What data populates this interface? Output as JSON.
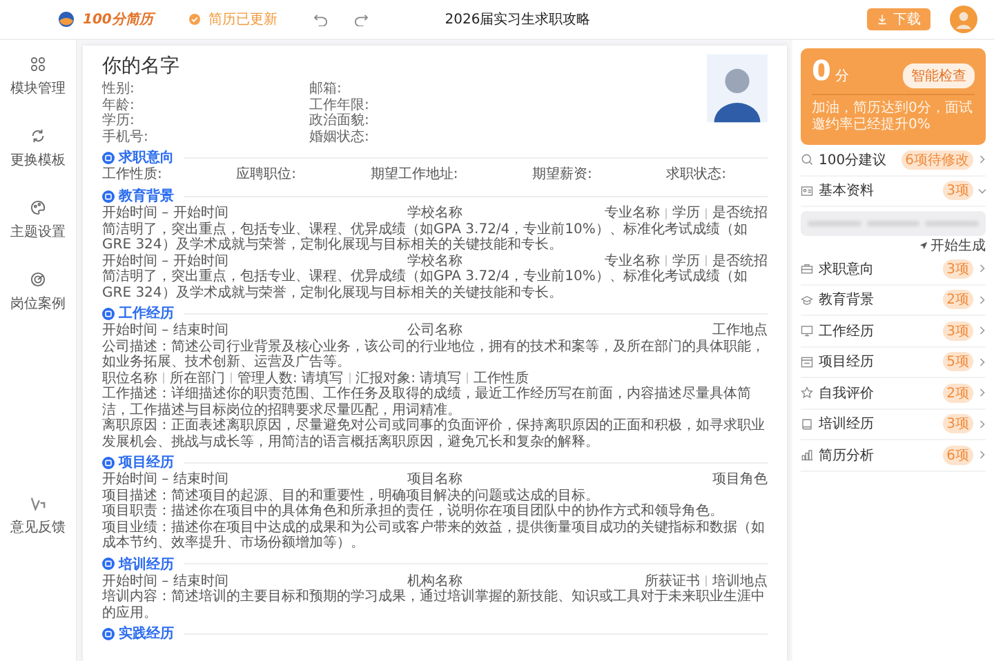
{
  "topbar": {
    "logo_text": "100分简历",
    "status": "简历已更新",
    "title": "2026届实习生求职攻略",
    "download": "下载"
  },
  "sidebar": {
    "items": [
      {
        "label": "模块管理"
      },
      {
        "label": "更换模板"
      },
      {
        "label": "主题设置"
      },
      {
        "label": "岗位案例"
      }
    ],
    "bottom_item": {
      "label": "意见反馈"
    }
  },
  "resume": {
    "name": "你的名字",
    "info": [
      [
        "性别:",
        "邮箱:"
      ],
      [
        "年龄:",
        "工作年限:"
      ],
      [
        "学历:",
        "政治面貌:"
      ],
      [
        "手机号:",
        "婚姻状态:"
      ]
    ],
    "sections": [
      {
        "title": "求职意向",
        "kind": "fields",
        "fields": [
          "工作性质:",
          "应聘职位:",
          "期望工作地址:",
          "期望薪资:",
          "求职状态:"
        ]
      },
      {
        "title": "教育背景",
        "kind": "entries",
        "entries": [
          {
            "date": "开始时间 – 开始时间",
            "name": "学校名称",
            "meta": [
              "专业名称",
              "学历",
              "是否统招"
            ],
            "lines": [
              "简洁明了，突出重点，包括专业、课程、优异成绩（如GPA 3.72/4，专业前10%）、标准化考试成绩（如GRE 324）及学术成就与荣誉，定制化展现与目标相关的关键技能和专长。"
            ]
          },
          {
            "date": "开始时间 – 开始时间",
            "name": "学校名称",
            "meta": [
              "专业名称",
              "学历",
              "是否统招"
            ],
            "lines": [
              "简洁明了，突出重点，包括专业、课程、优异成绩（如GPA 3.72/4，专业前10%）、标准化考试成绩（如GRE 324）及学术成就与荣誉，定制化展现与目标相关的关键技能和专长。"
            ]
          }
        ]
      },
      {
        "title": "工作经历",
        "kind": "entries",
        "entries": [
          {
            "date": "开始时间 – 结束时间",
            "name": "公司名称",
            "meta": [
              "工作地点"
            ],
            "lines": [
              "公司描述：简述公司行业背景及核心业务，该公司的行业地位，拥有的技术和案等，及所在部门的具体职能，如业务拓展、技术创新、运营及广告等。"
            ],
            "tags": [
              "职位名称",
              "所在部门",
              "管理人数: 请填写",
              "汇报对象: 请填写",
              "工作性质"
            ],
            "after": [
              "工作描述：详细描述你的职责范围、工作任务及取得的成绩，最近工作经历写在前面，内容描述尽量具体简洁，工作描述与目标岗位的招聘要求尽量匹配，用词精准。",
              "离职原因：正面表述离职原因，尽量避免对公司或同事的负面评价，保持离职原因的正面和积极，如寻求职业发展机会、挑战与成长等，用简洁的语言概括离职原因，避免冗长和复杂的解释。"
            ]
          }
        ]
      },
      {
        "title": "项目经历",
        "kind": "entries",
        "entries": [
          {
            "date": "开始时间 – 结束时间",
            "name": "项目名称",
            "meta": [
              "项目角色"
            ],
            "lines": [
              "项目描述：简述项目的起源、目的和重要性，明确项目解决的问题或达成的目标。",
              "项目职责：描述你在项目中的具体角色和所承担的责任，说明你在项目团队中的协作方式和领导角色。",
              "项目业绩：描述你在项目中达成的成果和为公司或客户带来的效益，提供衡量项目成功的关键指标和数据（如成本节约、效率提升、市场份额增加等）。"
            ]
          }
        ]
      },
      {
        "title": "培训经历",
        "kind": "entries",
        "entries": [
          {
            "date": "开始时间 – 结束时间",
            "name": "机构名称",
            "meta": [
              "所获证书",
              "培训地点"
            ],
            "lines": [
              "培训内容：简述培训的主要目标和预期的学习成果，通过培训掌握的新技能、知识或工具对于未来职业生涯中的应用。"
            ]
          }
        ]
      },
      {
        "title": "实践经历",
        "kind": "entries"
      }
    ]
  },
  "panel": {
    "score": "0",
    "unit": "分",
    "check_button": "智能检查",
    "message": "加油，简历达到0分，面试邀约率已经提升0%",
    "items": [
      {
        "label": "100分建议",
        "badge": "6项待修改",
        "expanded": false
      },
      {
        "label": "基本资料",
        "badge": "3项",
        "expanded": true,
        "action": "开始生成"
      },
      {
        "label": "求职意向",
        "badge": "3项",
        "expanded": false
      },
      {
        "label": "教育背景",
        "badge": "2项",
        "expanded": false
      },
      {
        "label": "工作经历",
        "badge": "3项",
        "expanded": false
      },
      {
        "label": "项目经历",
        "badge": "5项",
        "expanded": false
      },
      {
        "label": "自我评价",
        "badge": "2项",
        "expanded": false
      },
      {
        "label": "培训经历",
        "badge": "3项",
        "expanded": false
      },
      {
        "label": "简历分析",
        "badge": "6项",
        "expanded": false
      }
    ]
  }
}
